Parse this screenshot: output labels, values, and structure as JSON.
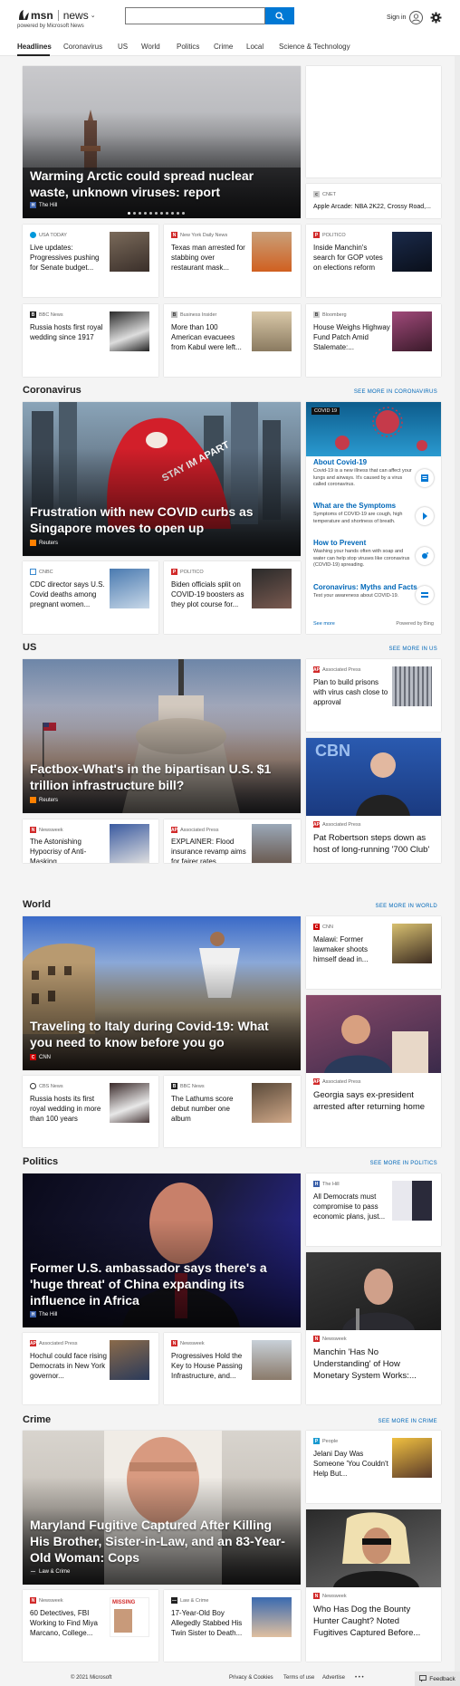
{
  "header": {
    "logo_msn": "msn",
    "logo_news": "news",
    "powered_by": "powered by Microsoft News",
    "search_placeholder": "",
    "sign_in": "Sign in"
  },
  "nav": [
    "Headlines",
    "Coronavirus",
    "US",
    "World",
    "Politics",
    "Crime",
    "Local",
    "Science & Technology"
  ],
  "headlines": {
    "hero": {
      "title": "Warming Arctic could spread nuclear waste, unknown viruses: report",
      "source": "The Hill"
    },
    "side_top": {
      "source": "CNET",
      "title": "Apple Arcade: NBA 2K22, Crossy Road,..."
    },
    "cards": [
      {
        "source": "USA TODAY",
        "title": "Live updates: Progressives pushing for Senate budget..."
      },
      {
        "source": "New York Daily News",
        "title": "Texas man arrested for stabbing over restaurant mask..."
      },
      {
        "source": "POLITICO",
        "title": "Inside Manchin's search for GOP votes on elections reform"
      },
      {
        "source": "BBC News",
        "title": "Russia hosts first royal wedding since 1917"
      },
      {
        "source": "Business Insider",
        "title": "More than 100 American evacuees from Kabul were left..."
      },
      {
        "source": "Bloomberg",
        "title": "House Weighs Highway Fund Patch Amid Stalemate:..."
      }
    ]
  },
  "coronavirus": {
    "section": "Coronavirus",
    "see_more": "SEE MORE IN CORONAVIRUS",
    "hero": {
      "title": "Frustration with new COVID curbs as Singapore moves to open up",
      "source": "Reuters",
      "sign_text": "STAY IM APART"
    },
    "cards": [
      {
        "source": "CNBC",
        "title": "CDC director says U.S. Covid deaths among pregnant women..."
      },
      {
        "source": "POLITICO",
        "title": "Biden officials split on COVID-19 boosters as they plot course for..."
      }
    ],
    "covid_panel": {
      "badge": "COVID 19",
      "items": [
        {
          "title": "About Covid-19",
          "desc": "Covid-19 is a new illness that can affect your lungs and airways. It's caused by a virus called coronavirus."
        },
        {
          "title": "What are the Symptoms",
          "desc": "Symptoms of COVID-19 are cough, high temperature and shortness of breath."
        },
        {
          "title": "How to Prevent",
          "desc": "Washing your hands often with soap and water can help stop viruses like coronavirus (COVID-19) spreading."
        },
        {
          "title": "Coronavirus: Myths and Facts",
          "desc": "Test your awareness about COVID-19."
        }
      ],
      "see_more": "See more",
      "powered": "Powered by Bing"
    }
  },
  "us": {
    "section": "US",
    "see_more": "SEE MORE IN US",
    "hero": {
      "title": "Factbox-What's in the bipartisan U.S. $1 trillion infrastructure bill?",
      "source": "Reuters"
    },
    "side_top": {
      "source": "Associated Press",
      "title": "Plan to build prisons with virus cash close to approval"
    },
    "side_bottom": {
      "source": "Associated Press",
      "title": "Pat Robertson steps down as host of long-running '700 Club'",
      "img_text": "CBN"
    },
    "cards": [
      {
        "source": "Newsweek",
        "title": "The Astonishing Hypocrisy of Anti-Masking..."
      },
      {
        "source": "Associated Press",
        "title": "EXPLAINER: Flood insurance revamp aims for fairer rates"
      }
    ]
  },
  "world": {
    "section": "World",
    "see_more": "SEE MORE IN WORLD",
    "hero": {
      "title": "Traveling to Italy during Covid-19: What you need to know before you go",
      "source": "CNN"
    },
    "side_top": {
      "source": "CNN",
      "title": "Malawi: Former lawmaker shoots himself dead in..."
    },
    "side_bottom": {
      "source": "Associated Press",
      "title": "Georgia says ex-president arrested after returning home"
    },
    "cards": [
      {
        "source": "CBS News",
        "title": "Russia hosts its first royal wedding in more than 100 years"
      },
      {
        "source": "BBC News",
        "title": "The Lathums score debut number one album"
      }
    ]
  },
  "politics": {
    "section": "Politics",
    "see_more": "SEE MORE IN POLITICS",
    "hero": {
      "title": "Former U.S. ambassador says there's a 'huge threat' of China expanding its influence in Africa",
      "source": "The Hill"
    },
    "side_top": {
      "source": "The Hill",
      "title": "All Democrats must compromise to pass economic plans, just..."
    },
    "side_bottom": {
      "source": "Newsweek",
      "title": "Manchin 'Has No Understanding' of How Monetary System Works:..."
    },
    "cards": [
      {
        "source": "Associated Press",
        "title": "Hochul could face rising Democrats in New York governor..."
      },
      {
        "source": "Newsweek",
        "title": "Progressives Hold the Key to House Passing Infrastructure, and..."
      }
    ]
  },
  "crime": {
    "section": "Crime",
    "see_more": "SEE MORE IN CRIME",
    "hero": {
      "title": "Maryland Fugitive Captured After Killing His Brother, Sister-in-Law, and an 83-Year-Old Woman: Cops",
      "source": "Law & Crime"
    },
    "side_top": {
      "source": "People",
      "title": "Jelani Day Was Someone 'You Couldn't Help But..."
    },
    "side_bottom": {
      "source": "Newsweek",
      "title": "Who Has Dog the Bounty Hunter Caught? Noted Fugitives Captured Before..."
    },
    "cards": [
      {
        "source": "Newsweek",
        "title": "60 Detectives, FBI Working to Find Miya Marcano, College...",
        "img_text": "MISSING"
      },
      {
        "source": "Law & Crime",
        "title": "17-Year-Old Boy Allegedly Stabbed His Twin Sister to Death..."
      }
    ]
  },
  "footer": {
    "copyright": "© 2021 Microsoft",
    "privacy": "Privacy & Cookies",
    "terms": "Terms of use",
    "advertise": "Advertise",
    "more": "• • •",
    "feedback": "Feedback"
  },
  "colors": {
    "accent": "#0078d4",
    "link": "#0067b8"
  }
}
